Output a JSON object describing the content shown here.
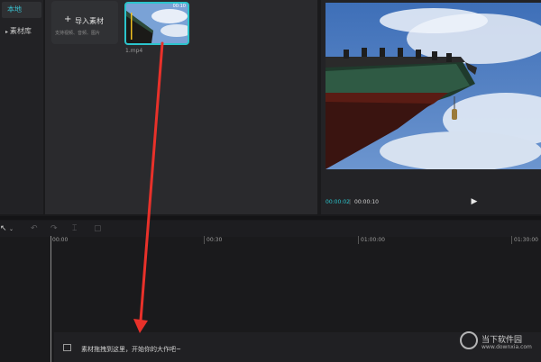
{
  "sidebar": {
    "items": [
      {
        "label": "本地"
      },
      {
        "label": "素材库"
      }
    ]
  },
  "media": {
    "import_label": "导入素材",
    "import_sub": "支持视频、音频、图片",
    "clip": {
      "name": "1.mp4",
      "duration": "00:10"
    }
  },
  "preview": {
    "time_current": "00:00:02",
    "time_total": "00:00:10"
  },
  "timeline": {
    "ticks": [
      "00:00",
      "00:30",
      "01:00:00",
      "01:30:00"
    ],
    "drop_hint": "素材拖拽到这里，开始你的大作吧~"
  },
  "watermark": {
    "text": "当下软件园",
    "url": "www.downxia.com"
  },
  "colors": {
    "accent": "#2bc4cc",
    "arrow": "#e8312a"
  }
}
